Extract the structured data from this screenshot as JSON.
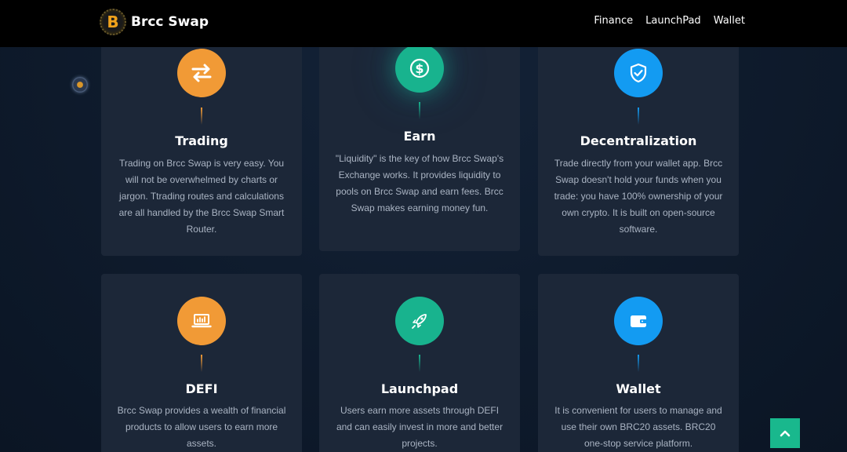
{
  "brand": {
    "name": "Brcc Swap",
    "logo_letter": "B"
  },
  "nav": {
    "items": [
      "Finance",
      "LaunchPad",
      "Wallet"
    ]
  },
  "colors": {
    "orange": "#f19a36",
    "green": "#18b38e",
    "blue": "#139bf2",
    "card_bg": "#1c2738"
  },
  "features": [
    {
      "title": "Trading",
      "icon": "swap-arrows-icon",
      "color": "orange",
      "text": "Trading on Brcc Swap is very easy. You will not be overwhelmed by charts or jargon. Ttrading routes and calculations are all handled by the Brcc Swap Smart Router."
    },
    {
      "title": "Earn",
      "icon": "dollar-coin-icon",
      "color": "green",
      "text": "\"Liquidity\" is the key of how Brcc Swap's Exchange works. It provides liquidity to pools on Brcc Swap and earn fees. Brcc Swap makes earning money fun."
    },
    {
      "title": "Decentralization",
      "icon": "shield-check-icon",
      "color": "blue",
      "text": "Trade directly from your wallet app. Brcc Swap doesn't hold your funds when you trade: you have 100% ownership of your own crypto. It is built on open-source software."
    },
    {
      "title": "DEFI",
      "icon": "laptop-chart-icon",
      "color": "orange",
      "text": "Brcc Swap provides a wealth of financial products to allow users to earn more assets."
    },
    {
      "title": "Launchpad",
      "icon": "rocket-icon",
      "color": "green",
      "text": "Users earn more assets through DEFI and can easily invest in more and better projects."
    },
    {
      "title": "Wallet",
      "icon": "wallet-icon",
      "color": "blue",
      "text": "It is convenient for users to manage and use their own BRC20 assets. BRC20 one-stop service platform."
    }
  ],
  "scroll_top": {
    "icon": "chevron-up-icon"
  }
}
